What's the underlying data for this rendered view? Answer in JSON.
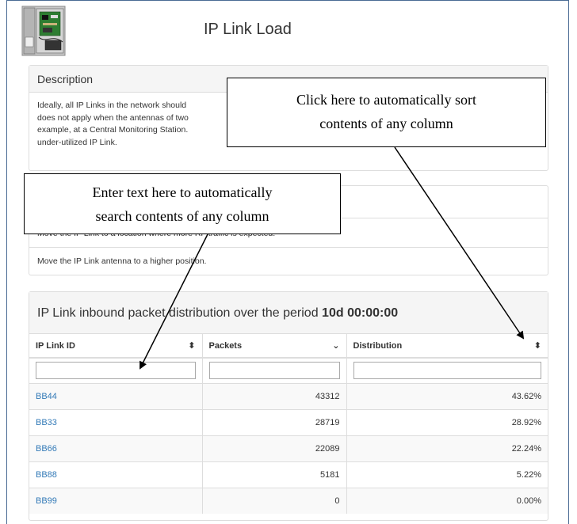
{
  "page": {
    "title": "IP Link Load"
  },
  "description": {
    "heading": "Description",
    "lines": [
      "Ideally, all IP Links in the network should",
      "does not apply when the antennas of two",
      "example, at a Central Monitoring Station.",
      "under-utilized IP Link."
    ]
  },
  "actions": {
    "items": [
      "Move the IP Link to a location where more RF traffic is expected.",
      "Move the IP Link antenna to a higher position."
    ]
  },
  "distribution": {
    "heading_prefix": "IP Link inbound packet distribution over the period ",
    "period": "10d 00:00:00",
    "columns": [
      {
        "label": "IP Link ID",
        "sort_icon": "sort-both-icon"
      },
      {
        "label": "Packets",
        "sort_icon": "sort-desc-icon"
      },
      {
        "label": "Distribution",
        "sort_icon": "sort-both-icon"
      }
    ],
    "rows": [
      {
        "id": "BB44",
        "packets": "43312",
        "distribution": "43.62%"
      },
      {
        "id": "BB33",
        "packets": "28719",
        "distribution": "28.92%"
      },
      {
        "id": "BB66",
        "packets": "22089",
        "distribution": "22.24%"
      },
      {
        "id": "BB88",
        "packets": "5181",
        "distribution": "5.22%"
      },
      {
        "id": "BB99",
        "packets": "0",
        "distribution": "0.00%"
      }
    ]
  },
  "callouts": {
    "sort_line1": "Click here to automatically sort",
    "sort_line2": "contents of any column",
    "search_line1": "Enter text here to automatically",
    "search_line2": "search contents of any column"
  },
  "colors": {
    "link": "#337ab7",
    "frame": "#4a6b94",
    "panel_border": "#dddddd",
    "panel_head_bg": "#f5f5f5"
  }
}
